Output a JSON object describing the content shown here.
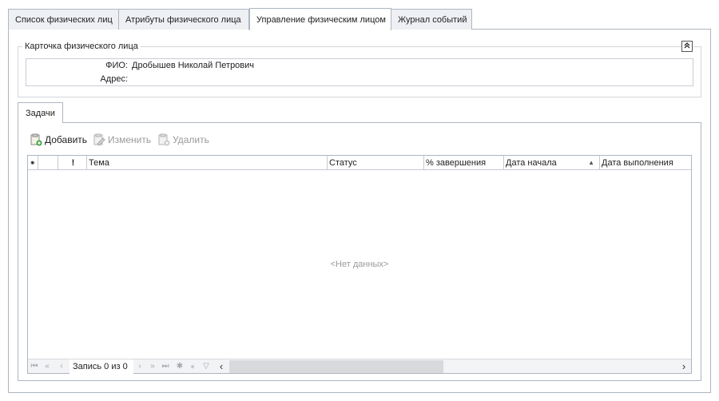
{
  "tabs": [
    {
      "label": "Список физических лиц",
      "active": false
    },
    {
      "label": "Атрибуты физического лица",
      "active": false
    },
    {
      "label": "Управление физическим лицом",
      "active": true
    },
    {
      "label": "Журнал событий",
      "active": false
    }
  ],
  "card": {
    "title": "Карточка физического лица",
    "collapse_glyph": "⌃",
    "fio_label": "ФИО:",
    "fio_value": "Дробышев Николай Петрович",
    "address_label": "Адрес:",
    "address_value": ""
  },
  "tasks_tab": {
    "label": "Задачи"
  },
  "toolbar": {
    "add_label": "Добавить",
    "edit_label": "Изменить",
    "delete_label": "Удалить"
  },
  "grid": {
    "columns": [
      {
        "label": "⁕"
      },
      {
        "label": ""
      },
      {
        "label": "!"
      },
      {
        "label": "Тема"
      },
      {
        "label": "Статус"
      },
      {
        "label": "% завершения"
      },
      {
        "label": "Дата начала"
      },
      {
        "label": "Дата выполнения"
      }
    ],
    "sort_indicator": "▲",
    "empty_text": "<Нет данных>"
  },
  "navigator": {
    "record_text": "Запись 0 из 0",
    "first": "⏮",
    "prev_page": "«",
    "prev": "‹",
    "next": "›",
    "next_page": "»",
    "last": "⏭",
    "append": "✱",
    "insert": "⁎",
    "filter": "▽",
    "scroll_left": "‹",
    "scroll_right": "›"
  },
  "colors": {
    "border": "#aeb6c1",
    "disabled_text": "#9a9a9a",
    "tab_bg": "#eef0f3"
  }
}
